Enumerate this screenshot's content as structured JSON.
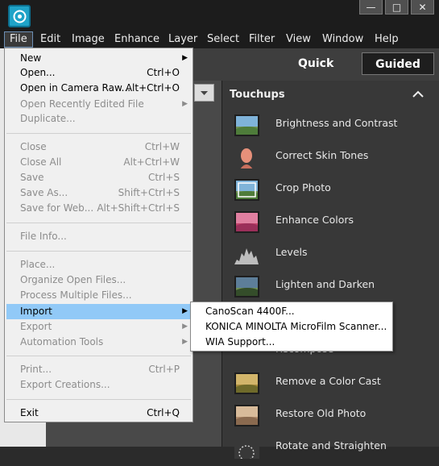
{
  "menubar": [
    "File",
    "Edit",
    "Image",
    "Enhance",
    "Layer",
    "Select",
    "Filter",
    "View",
    "Window",
    "Help"
  ],
  "window_controls": {
    "minimize": "—",
    "restore": "□",
    "close": "✕"
  },
  "mode": {
    "quick": "Quick",
    "guided": "Guided"
  },
  "panel": {
    "title": "Touchups",
    "items": [
      "Brightness and Contrast",
      "Correct Skin Tones",
      "Crop Photo",
      "Enhance Colors",
      "Levels",
      "Lighten and Darken",
      "Recompose",
      "Remove a Color Cast",
      "Restore Old Photo",
      "Rotate and Straighten"
    ]
  },
  "file_menu": {
    "new": {
      "label": "New"
    },
    "open": {
      "label": "Open...",
      "shortcut": "Ctrl+O"
    },
    "open_raw": {
      "label": "Open in Camera Raw...",
      "shortcut": "Alt+Ctrl+O"
    },
    "open_recent": {
      "label": "Open Recently Edited File"
    },
    "duplicate": {
      "label": "Duplicate..."
    },
    "close": {
      "label": "Close",
      "shortcut": "Ctrl+W"
    },
    "close_all": {
      "label": "Close All",
      "shortcut": "Alt+Ctrl+W"
    },
    "save": {
      "label": "Save",
      "shortcut": "Ctrl+S"
    },
    "save_as": {
      "label": "Save As...",
      "shortcut": "Shift+Ctrl+S"
    },
    "save_web": {
      "label": "Save for Web...",
      "shortcut": "Alt+Shift+Ctrl+S"
    },
    "file_info": {
      "label": "File Info..."
    },
    "place": {
      "label": "Place..."
    },
    "organize": {
      "label": "Organize Open Files..."
    },
    "process": {
      "label": "Process Multiple Files..."
    },
    "import": {
      "label": "Import"
    },
    "export": {
      "label": "Export"
    },
    "automation": {
      "label": "Automation Tools"
    },
    "print": {
      "label": "Print...",
      "shortcut": "Ctrl+P"
    },
    "export_creations": {
      "label": "Export Creations..."
    },
    "exit": {
      "label": "Exit",
      "shortcut": "Ctrl+Q"
    },
    "submenu_arrow": "▶"
  },
  "import_submenu": [
    "CanoScan 4400F...",
    "KONICA MINOLTA MicroFilm Scanner...",
    "WIA Support..."
  ],
  "icons": {
    "collapse": "chevron-up",
    "dropdown": "chevron-down"
  }
}
